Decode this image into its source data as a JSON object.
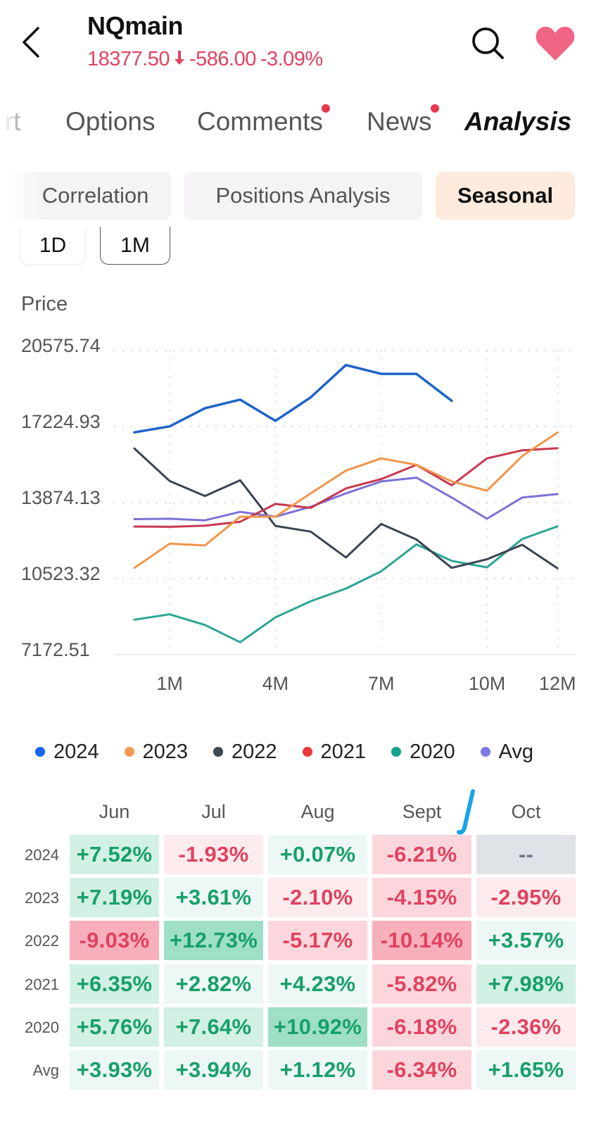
{
  "header": {
    "title": "NQmain",
    "price": "18377.50",
    "direction_icon": "arrow-down-icon",
    "change": "-586.00",
    "change_pct": "-3.09%",
    "down_color": "#e0425f",
    "favorite_color": "#f06584"
  },
  "tabs": [
    {
      "label": "Chart",
      "visible_text": "art",
      "active": false,
      "has_dot": false
    },
    {
      "label": "Options",
      "active": false,
      "has_dot": false
    },
    {
      "label": "Comments",
      "active": false,
      "has_dot": true
    },
    {
      "label": "News",
      "active": false,
      "has_dot": true
    },
    {
      "label": "Analysis",
      "active": true,
      "has_dot": false
    }
  ],
  "subtabs": [
    {
      "label": "Correlation",
      "active": false
    },
    {
      "label": "Positions Analysis",
      "active": false
    },
    {
      "label": "Seasonal",
      "active": true
    }
  ],
  "periods": [
    {
      "label": "1D",
      "active": false
    },
    {
      "label": "1M",
      "active": true
    }
  ],
  "price_label": "Price",
  "chart_data": {
    "type": "line",
    "title": "",
    "ylabel": "Price",
    "xlabel": "",
    "x": [
      0,
      1,
      2,
      3,
      4,
      5,
      6,
      7,
      8,
      9,
      10,
      11,
      12
    ],
    "x_tick_values": [
      1,
      4,
      7,
      10,
      12
    ],
    "x_tick_labels": [
      "1M",
      "4M",
      "7M",
      "10M",
      "12M"
    ],
    "y_tick_labels": [
      "20575.74",
      "17224.93",
      "13874.13",
      "10523.32",
      "7172.51"
    ],
    "y_tick_values": [
      20575.74,
      17224.93,
      13874.13,
      10523.32,
      7172.51
    ],
    "ylim": [
      7172.51,
      20575.74
    ],
    "grid": true,
    "legend_position": "bottom",
    "series": [
      {
        "name": "2024",
        "color": "#1e63c8",
        "legend_color": "#1766f0",
        "values": [
          16970,
          17235,
          18036,
          18413,
          17478,
          18514,
          19936,
          19549,
          19549,
          18362
        ]
      },
      {
        "name": "2023",
        "color": "#f0954a",
        "legend_color": "#f59a50",
        "values": [
          10999,
          12065,
          11986,
          13253,
          13253,
          14280,
          15285,
          15824,
          15538,
          14807,
          14402,
          15925,
          16960
        ]
      },
      {
        "name": "2022",
        "color": "#3b4452",
        "legend_color": "#3d4655",
        "values": [
          16260,
          14828,
          14167,
          14859,
          12848,
          12595,
          11456,
          12930,
          12248,
          10999,
          11377,
          12017,
          10979
        ]
      },
      {
        "name": "2021",
        "color": "#c8384f",
        "legend_color": "#e83a3a",
        "values": [
          12818,
          12808,
          12857,
          13031,
          13814,
          13640,
          14502,
          14910,
          15538,
          14636,
          15824,
          16178,
          16269
        ]
      },
      {
        "name": "2020",
        "color": "#2ba594",
        "legend_color": "#14a38f",
        "values": [
          8715,
          8949,
          8483,
          7722,
          8818,
          9528,
          10086,
          10847,
          12035,
          11304,
          11021,
          12270,
          12828
        ]
      },
      {
        "name": "Avg",
        "color": "#7b72d6",
        "legend_color": "#7a7ae8",
        "values": [
          13144,
          13164,
          13092,
          13467,
          13253,
          13692,
          14280,
          14807,
          14971,
          14097,
          13164,
          14097,
          14249
        ]
      }
    ]
  },
  "table": {
    "columns": [
      "Jun",
      "Jul",
      "Aug",
      "Sept",
      "Oct"
    ],
    "rows": [
      {
        "label": "2024",
        "cells": [
          {
            "text": "+7.52%",
            "value": 7.52
          },
          {
            "text": "-1.93%",
            "value": -1.93
          },
          {
            "text": "+0.07%",
            "value": 0.07
          },
          {
            "text": "-6.21%",
            "value": -6.21
          },
          {
            "text": "--",
            "value": null
          }
        ]
      },
      {
        "label": "2023",
        "cells": [
          {
            "text": "+7.19%",
            "value": 7.19
          },
          {
            "text": "+3.61%",
            "value": 3.61
          },
          {
            "text": "-2.10%",
            "value": -2.1
          },
          {
            "text": "-4.15%",
            "value": -4.15
          },
          {
            "text": "-2.95%",
            "value": -2.95
          }
        ]
      },
      {
        "label": "2022",
        "cells": [
          {
            "text": "-9.03%",
            "value": -9.03
          },
          {
            "text": "+12.73%",
            "value": 12.73
          },
          {
            "text": "-5.17%",
            "value": -5.17
          },
          {
            "text": "-10.14%",
            "value": -10.14
          },
          {
            "text": "+3.57%",
            "value": 3.57
          }
        ]
      },
      {
        "label": "2021",
        "cells": [
          {
            "text": "+6.35%",
            "value": 6.35
          },
          {
            "text": "+2.82%",
            "value": 2.82
          },
          {
            "text": "+4.23%",
            "value": 4.23
          },
          {
            "text": "-5.82%",
            "value": -5.82
          },
          {
            "text": "+7.98%",
            "value": 7.98
          }
        ]
      },
      {
        "label": "2020",
        "cells": [
          {
            "text": "+5.76%",
            "value": 5.76
          },
          {
            "text": "+7.64%",
            "value": 7.64
          },
          {
            "text": "+10.92%",
            "value": 10.92
          },
          {
            "text": "-6.18%",
            "value": -6.18
          },
          {
            "text": "-2.36%",
            "value": -2.36
          }
        ]
      },
      {
        "label": "Avg",
        "cells": [
          {
            "text": "+3.93%",
            "value": 3.93
          },
          {
            "text": "+3.94%",
            "value": 3.94
          },
          {
            "text": "+1.12%",
            "value": 1.12
          },
          {
            "text": "-6.34%",
            "value": -6.34
          },
          {
            "text": "+1.65%",
            "value": 1.65
          }
        ]
      }
    ],
    "heat_colors": {
      "pos_strong": "#9fdfc6",
      "pos_mid": "#d2f0e3",
      "pos_weak": "#edf7f6",
      "neg_weak": "#fdebed",
      "neg_mid": "#fbd7dd",
      "neg_strong": "#f7afbc",
      "empty": "#dfe3e8"
    }
  },
  "annotation": {
    "color": "#1aa3e8"
  }
}
